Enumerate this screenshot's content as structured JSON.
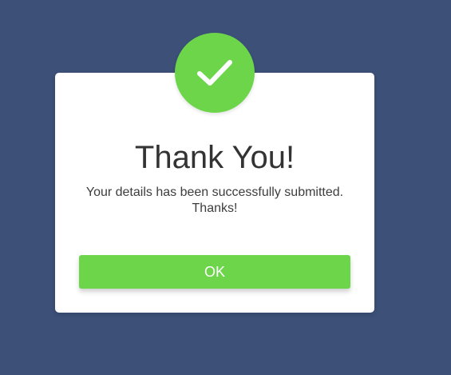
{
  "dialog": {
    "title": "Thank You!",
    "message_line1": "Your details has been successfully submitted.",
    "message_line2": "Thanks!",
    "ok_label": "OK"
  },
  "colors": {
    "background": "#3c5078",
    "accent": "#6dd54a",
    "card": "#ffffff"
  },
  "icons": {
    "badge": "checkmark-icon"
  }
}
